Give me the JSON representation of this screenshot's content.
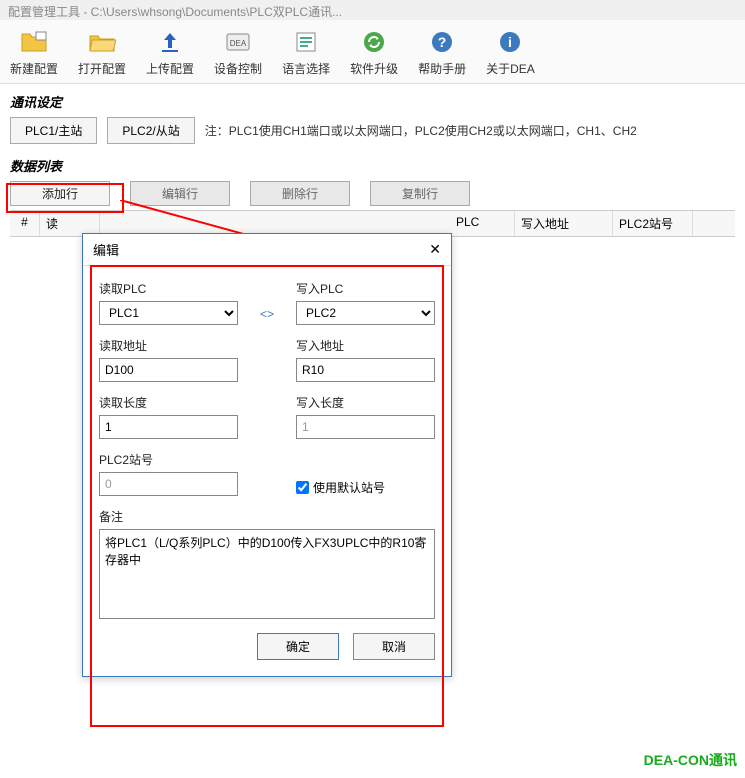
{
  "titlebar": "配置管理工具 - C:\\Users\\whsong\\Documents\\PLC双PLC通讯...",
  "toolbar": [
    {
      "label": "新建配置",
      "icon": "folder-new"
    },
    {
      "label": "打开配置",
      "icon": "folder-open"
    },
    {
      "label": "上传配置",
      "icon": "upload"
    },
    {
      "label": "设备控制",
      "icon": "device"
    },
    {
      "label": "语言选择",
      "icon": "language"
    },
    {
      "label": "软件升级",
      "icon": "upgrade"
    },
    {
      "label": "帮助手册",
      "icon": "help"
    },
    {
      "label": "关于DEA",
      "icon": "about"
    }
  ],
  "comm": {
    "title": "通讯设定",
    "plc1_btn": "PLC1/主站",
    "plc2_btn": "PLC2/从站",
    "note": "注：PLC1使用CH1端口或以太网端口，PLC2使用CH2或以太网端口，CH1、CH2"
  },
  "datalist": {
    "title": "数据列表",
    "add_row": "添加行",
    "edit_row": "编辑行",
    "delete_row": "删除行",
    "copy_row": "复制行",
    "headers": {
      "num": "#",
      "a": "读",
      "write_plc": "PLC",
      "write_addr": "写入地址",
      "plc2_station": "PLC2站号"
    }
  },
  "dialog": {
    "title": "编辑",
    "read_plc_label": "读取PLC",
    "read_plc_value": "PLC1",
    "write_plc_label": "写入PLC",
    "write_plc_value": "PLC2",
    "swap": "<>",
    "read_addr_label": "读取地址",
    "read_addr_value": "D100",
    "write_addr_label": "写入地址",
    "write_addr_value": "R10",
    "read_len_label": "读取长度",
    "read_len_value": "1",
    "write_len_label": "写入长度",
    "write_len_value": "1",
    "plc2_station_label": "PLC2站号",
    "plc2_station_value": "0",
    "use_default_station": "使用默认站号",
    "remark_label": "备注",
    "remark_value": "将PLC1（L/Q系列PLC）中的D100传入FX3UPLC中的R10寄存器中",
    "ok": "确定",
    "cancel": "取消"
  },
  "footer": "DEA-CON通讯"
}
